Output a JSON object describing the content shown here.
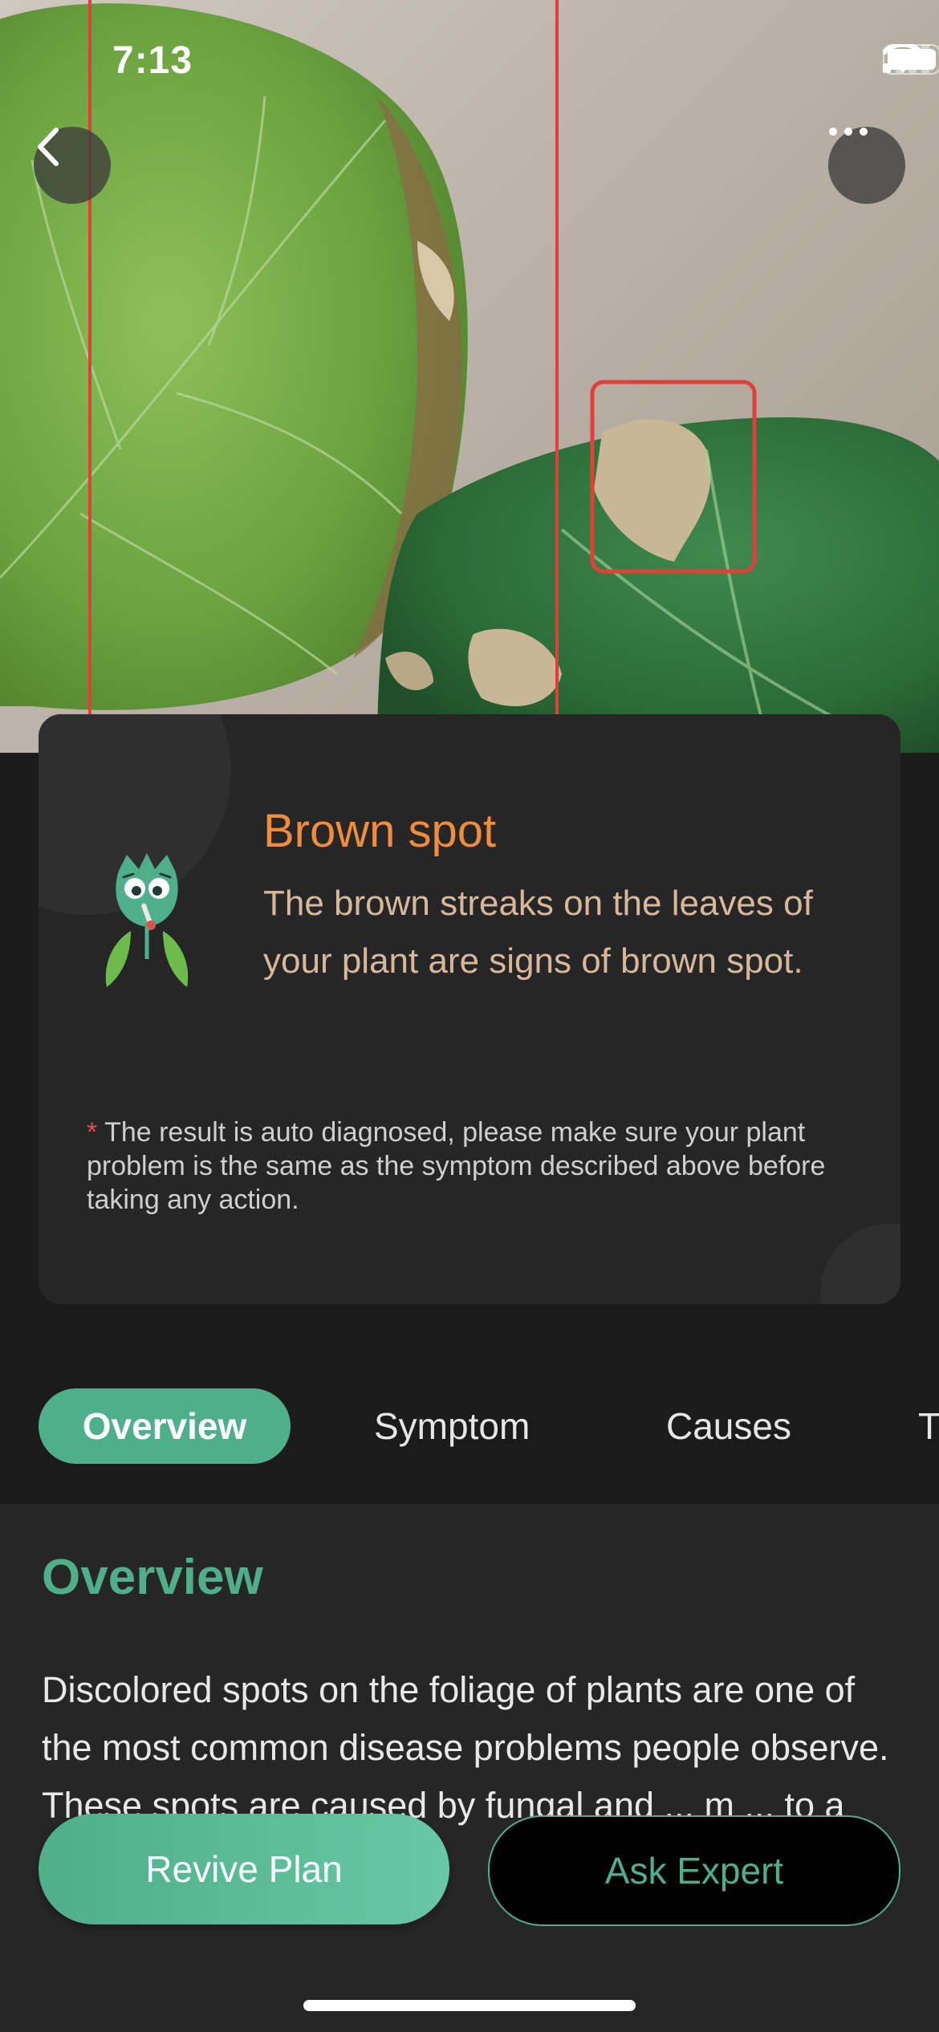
{
  "status_bar": {
    "time": "7:13"
  },
  "header": {
    "back_icon": "chevron-left-icon",
    "more_icon": "ellipsis-icon"
  },
  "diagnosis": {
    "title": "Brown spot",
    "description": "The brown streaks on the leaves of your plant are signs of brown spot.",
    "disclaimer_mark": "*",
    "disclaimer": "The result is auto diagnosed, please make sure your plant problem is the same as the symptom described above before taking any action.",
    "mascot_icon": "sick-plant-mascot-icon"
  },
  "tabs": [
    {
      "label": "Overview",
      "active": true
    },
    {
      "label": "Symptom",
      "active": false
    },
    {
      "label": "Causes",
      "active": false
    },
    {
      "label": "T",
      "active": false
    }
  ],
  "overview": {
    "title": "Overview",
    "text": "Discolored spots on the foliage of plants are one of the most common disease problems people observe. These spots are caused by fungal and ... m ... to a fungal pathogen."
  },
  "actions": {
    "revive_plan": "Revive Plan",
    "ask_expert": "Ask Expert"
  },
  "colors": {
    "accent": "#4fae8c",
    "disease_title": "#f08c3e",
    "description": "#d9b89a",
    "highlight_box": "#e0403a"
  }
}
